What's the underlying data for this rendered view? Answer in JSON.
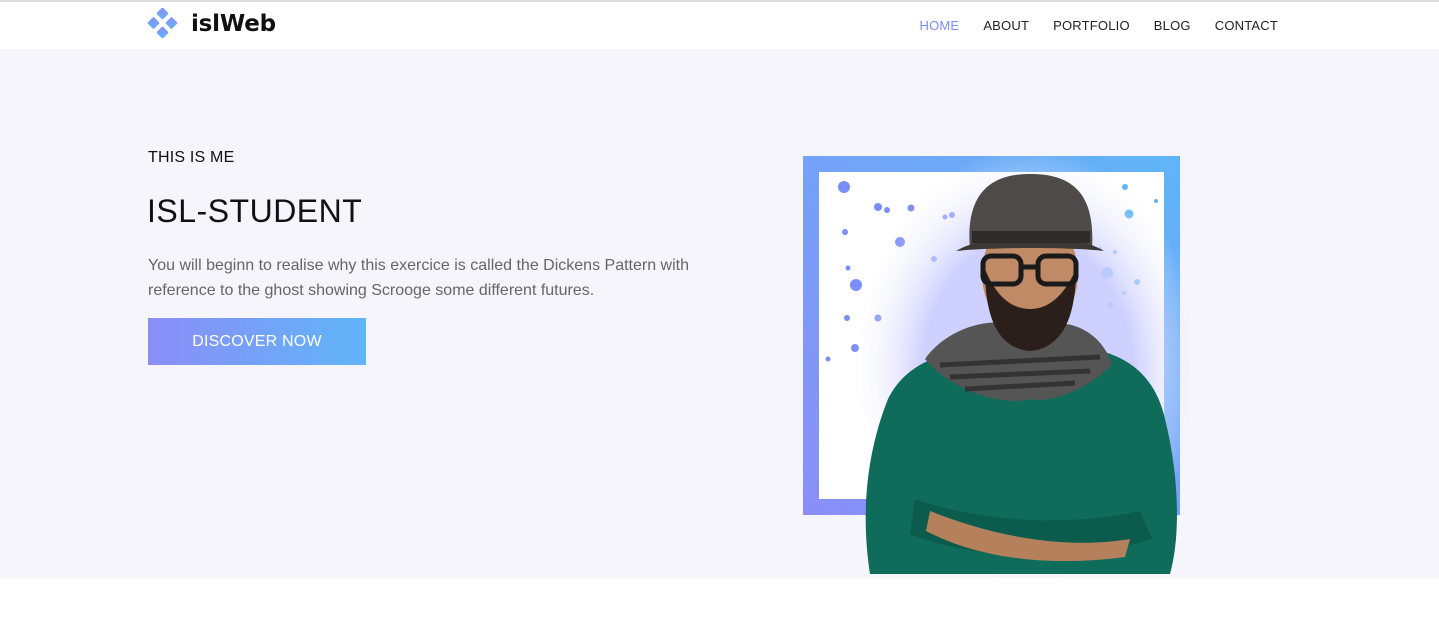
{
  "brand": {
    "name": "islWeb",
    "logo_icon": "diamond-cluster-icon",
    "logo_color": "#7b8ef7"
  },
  "nav": {
    "items": [
      {
        "label": "HOME",
        "active": true
      },
      {
        "label": "ABOUT",
        "active": false
      },
      {
        "label": "PORTFOLIO",
        "active": false
      },
      {
        "label": "BLOG",
        "active": false
      },
      {
        "label": "CONTACT",
        "active": false
      }
    ],
    "active_color": "#7b8ef7"
  },
  "hero": {
    "eyebrow": "THIS IS ME",
    "title": "ISL-STUDENT",
    "description": "You will beginn to realise why this exercice is called the Dickens Pattern with reference to the ghost showing Scrooge some different futures.",
    "cta_label": "DISCOVER NOW",
    "cta_gradient": [
      "#8b8ef8",
      "#5fb5f7"
    ],
    "background": "#f5f5fb"
  },
  "portrait": {
    "subject": "man-with-hat-and-glasses-portrait",
    "frame_gradient": [
      "#8b8ef8",
      "#5fb5f7"
    ]
  }
}
